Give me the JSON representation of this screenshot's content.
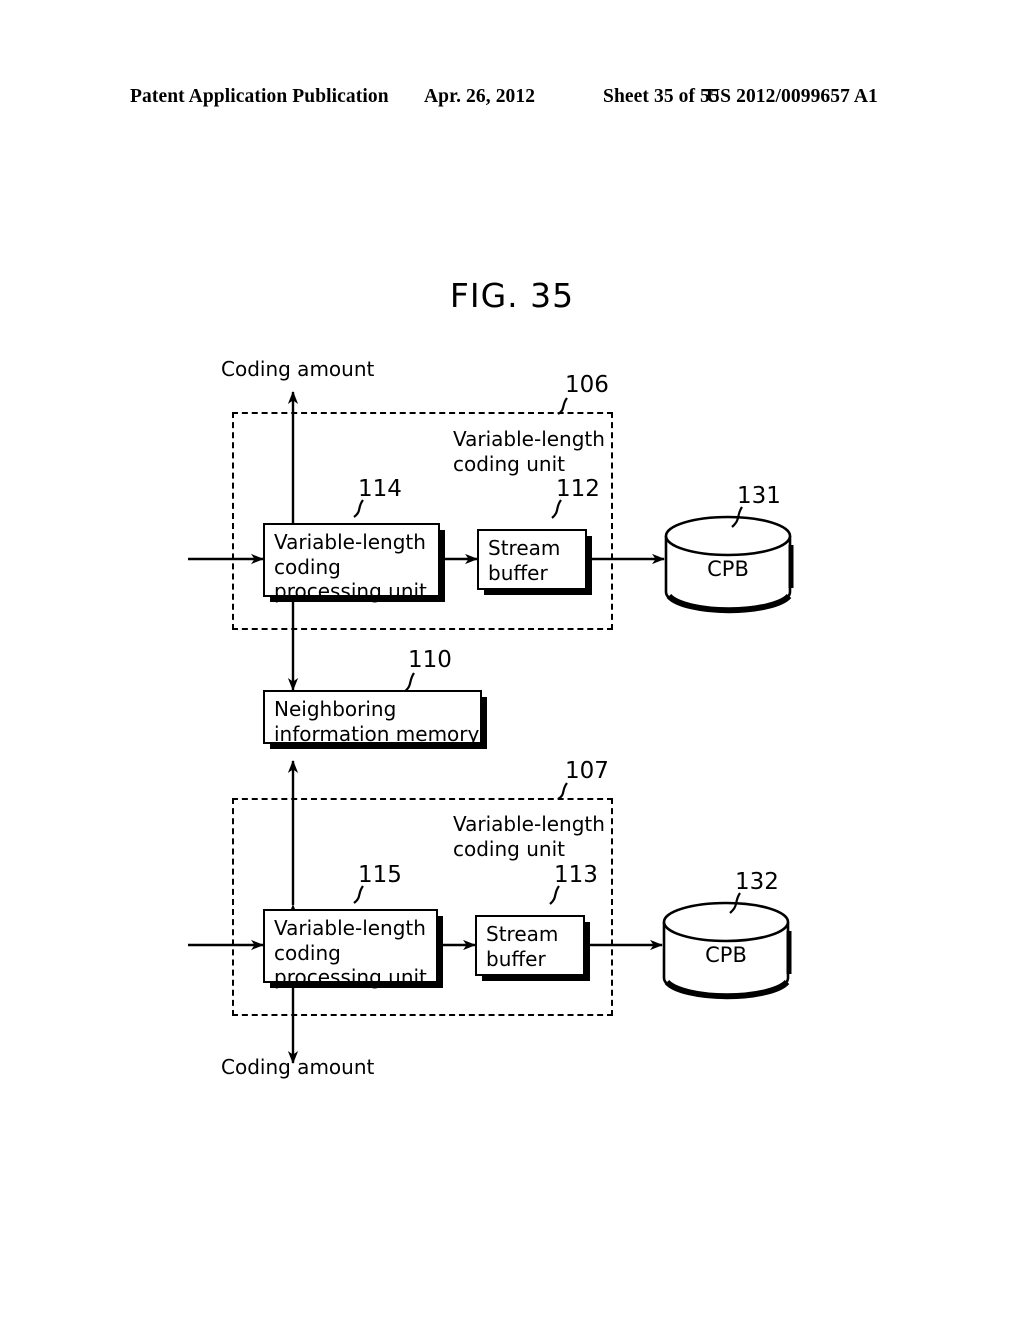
{
  "header": {
    "publication": "Patent Application Publication",
    "date": "Apr. 26, 2012",
    "sheet": "Sheet 35 of 55",
    "patent_number": "US 2012/0099657 A1"
  },
  "figure": {
    "title": "FIG. 35"
  },
  "diagram": {
    "top_signal_label": "Coding amount",
    "bottom_signal_label": "Coding amount",
    "groups": [
      {
        "ref": "106",
        "title_line1": "Variable-length",
        "title_line2": "coding unit"
      },
      {
        "ref": "107",
        "title_line1": "Variable-length",
        "title_line2": "coding unit"
      }
    ],
    "blocks": [
      {
        "ref": "114",
        "line1": "Variable-length",
        "line2": "coding",
        "line3": "processing unit"
      },
      {
        "ref": "112",
        "line1": "Stream",
        "line2": "buffer"
      },
      {
        "ref": "110",
        "line1": "Neighboring",
        "line2": "information memory"
      },
      {
        "ref": "115",
        "line1": "Variable-length",
        "line2": "coding",
        "line3": "processing unit"
      },
      {
        "ref": "113",
        "line1": "Stream",
        "line2": "buffer"
      }
    ],
    "stores": [
      {
        "ref": "131",
        "label": "CPB"
      },
      {
        "ref": "132",
        "label": "CPB"
      }
    ]
  },
  "colors": {
    "ink": "#000000",
    "paper": "#ffffff"
  }
}
